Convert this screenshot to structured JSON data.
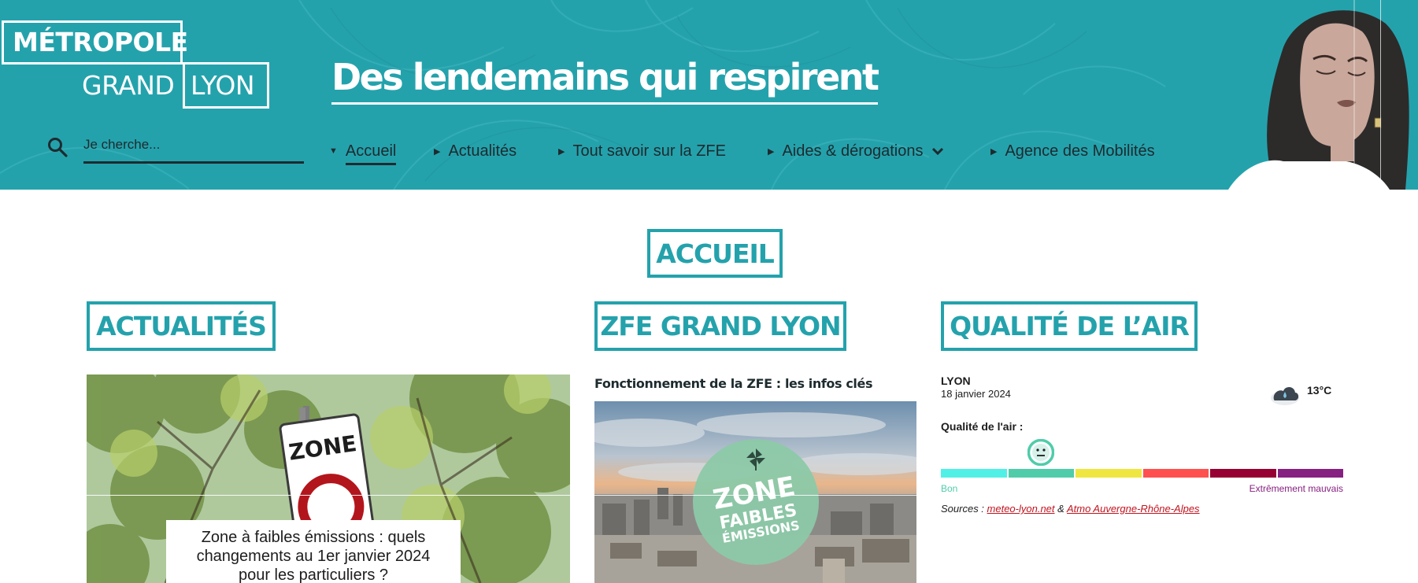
{
  "header": {
    "logo": {
      "line1": "MÉTROPOLE",
      "line2": "GRAND",
      "line3": "LYON"
    },
    "tagline": "Des lendemains qui respirent",
    "search": {
      "placeholder": "Je cherche..."
    },
    "nav": {
      "items": [
        {
          "label": "Accueil",
          "active": true
        },
        {
          "label": "Actualités"
        },
        {
          "label": "Tout savoir sur la ZFE"
        },
        {
          "label": "Aides & dérogations",
          "has_dropdown": true
        },
        {
          "label": "Agence des Mobilités"
        }
      ]
    }
  },
  "page_title": "ACCUEIL",
  "actualites": {
    "title": "ACTUALITÉS",
    "featured": {
      "sign_text": "ZONE",
      "headline": "Zone à faibles émissions : quels changements au 1er janvier 2024 pour les particuliers ?"
    }
  },
  "zfe": {
    "title": "ZFE GRAND LYON",
    "subtitle": "Fonctionnement de la ZFE : les infos clés",
    "badge": {
      "line1": "ZONE",
      "line2": "FAIBLES",
      "line3": "ÉMISSIONS"
    }
  },
  "air_quality": {
    "title": "QUALITÉ DE L’AIR",
    "city": "LYON",
    "date": "18 janvier 2024",
    "weather_icon": "cloud-rain-icon",
    "temperature": "13°C",
    "label": "Qualité de l'air :",
    "current_level_index": 1,
    "scale_colors": [
      "#50f0e6",
      "#50ccaa",
      "#f0e641",
      "#ff5050",
      "#960032",
      "#872181"
    ],
    "min_label": "Bon",
    "max_label": "Extrêmement mauvais",
    "sources_prefix": "Sources : ",
    "source1": "meteo-lyon.net",
    "sources_sep": " & ",
    "source2": "Atmo Auvergne-Rhône-Alpes"
  },
  "colors": {
    "brand_teal": "#24a2ac",
    "dark_text": "#1d2b2f",
    "link_red": "#c0141f"
  }
}
